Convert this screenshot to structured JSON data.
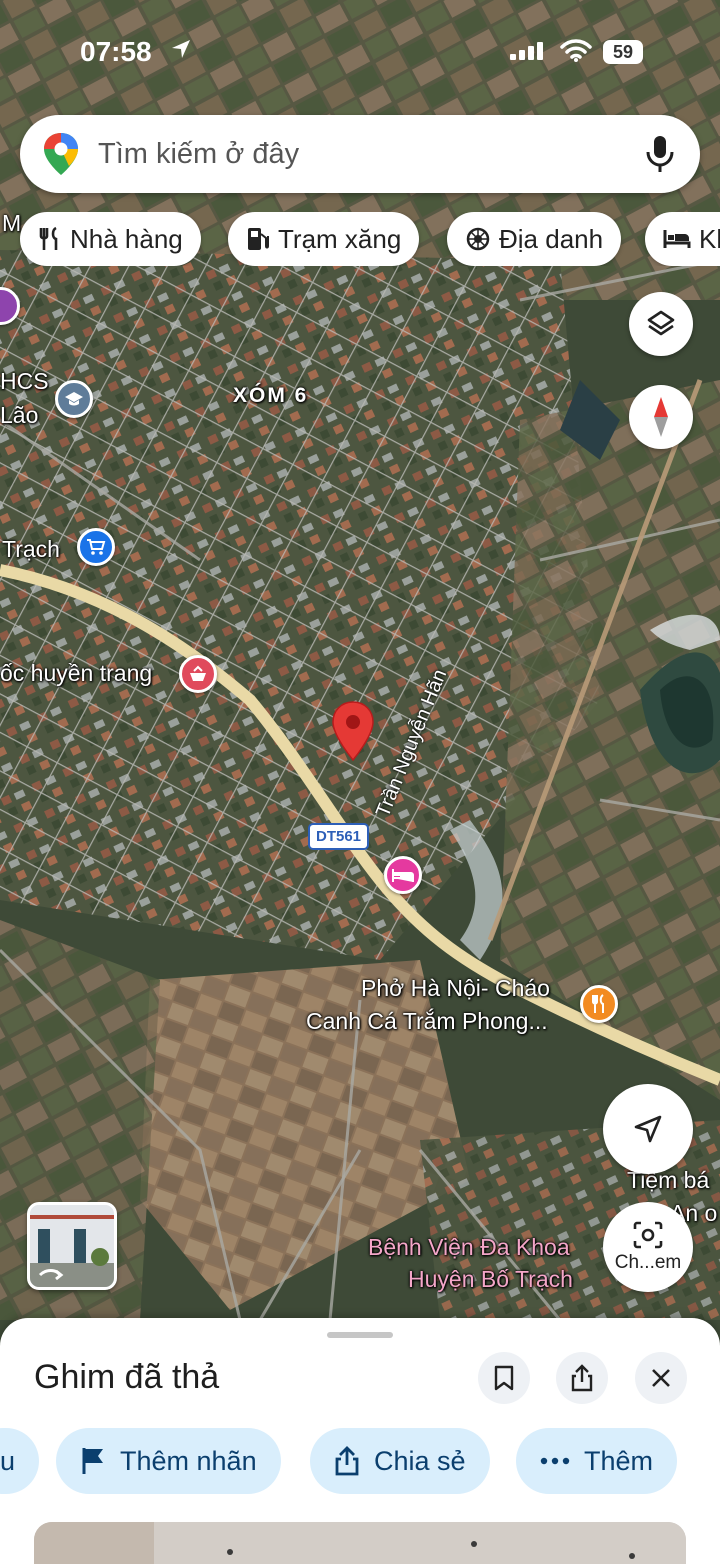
{
  "status_bar": {
    "time": "07:58",
    "battery": "59"
  },
  "search": {
    "placeholder": "Tìm kiếm ở đây"
  },
  "chips": [
    {
      "label": "Nhà hàng",
      "icon": "fork-knife-icon"
    },
    {
      "label": "Trạm xăng",
      "icon": "gas-pump-icon"
    },
    {
      "label": "Địa danh",
      "icon": "landmark-icon"
    },
    {
      "label": "Kh",
      "icon": "bed-icon"
    }
  ],
  "map": {
    "area_label": "XÓM 6",
    "road_shield": "DT561",
    "road_name": "Trần Nguyễn Hãn",
    "labels": {
      "left_top": "M",
      "school_1": "HCS",
      "school_2": "Lão",
      "shop": "Trạch",
      "snail": "ốc huyền trang",
      "pho_1": "Phở Hà Nội- Cháo",
      "pho_2": "Canh Cá Trắm Phong...",
      "tiem_1": "Tiệm bá",
      "tiem_2": "An o",
      "hospital_1": "Bệnh Viện Đa Khoa",
      "hospital_2": "Huyện Bố Trạch"
    },
    "lens_label": "Ch...em",
    "colors": {
      "pin": "#e53935",
      "restaurant": "#f28b22",
      "hotel": "#e5399f",
      "shopping": "#1a73e8",
      "school": "#5f7c99",
      "snail": "#e04a5c",
      "main_road": "#e9d9a6"
    }
  },
  "sheet": {
    "title": "Ghim đã thả",
    "actions": [
      {
        "label": "u",
        "icon": ""
      },
      {
        "label": "Thêm nhãn",
        "icon": "flag-icon"
      },
      {
        "label": "Chia sẻ",
        "icon": "share-icon"
      },
      {
        "label": "Thêm",
        "icon": "more-dots-icon"
      }
    ]
  }
}
